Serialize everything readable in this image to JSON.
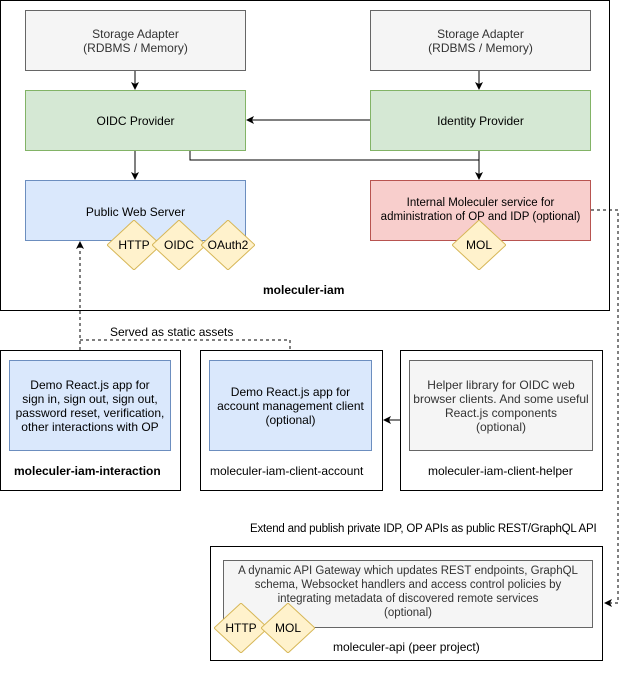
{
  "iam": {
    "label": "moleculer-iam",
    "storage_left": "Storage Adapter\n(RDBMS / Memory)",
    "storage_right": "Storage Adapter\n(RDBMS / Memory)",
    "oidc_provider": "OIDC Provider",
    "identity_provider": "Identity Provider",
    "public_web_server": "Public Web Server",
    "internal_service": "Internal Moleculer service for\nadministration of OP and IDP (optional)",
    "pws_protocols": [
      "HTTP",
      "OIDC",
      "OAuth2"
    ],
    "internal_protocol": "MOL"
  },
  "edges": {
    "served_static": "Served as static assets",
    "extend_publish": "Extend and publish private IDP, OP APIs as public REST/GraphQL API"
  },
  "interaction": {
    "label": "moleculer-iam-interaction",
    "desc": "Demo React.js app for\nsign in, sign out, sign out,\npassword reset, verification,\nother interactions with OP"
  },
  "client_account": {
    "label": "moleculer-iam-client-account",
    "desc": "Demo React.js app for\naccount management client\n(optional)"
  },
  "client_helper": {
    "label": "moleculer-iam-client-helper",
    "desc": "Helper library for OIDC web\nbrowser clients. And some useful\nReact.js components\n(optional)"
  },
  "api": {
    "label": "moleculer-api (peer project)",
    "desc": "A dynamic API Gateway which updates REST endpoints, GraphQL\nschema, Websocket handlers and access control policies by\nintegrating metadata of discovered remote services\n(optional)",
    "protocols": [
      "HTTP",
      "MOL"
    ]
  },
  "colors": {
    "green": "#d5e8d4",
    "blue": "#dae8fc",
    "red": "#f8cecc",
    "gray": "#f5f5f5",
    "diamond": "#fff2cc"
  }
}
